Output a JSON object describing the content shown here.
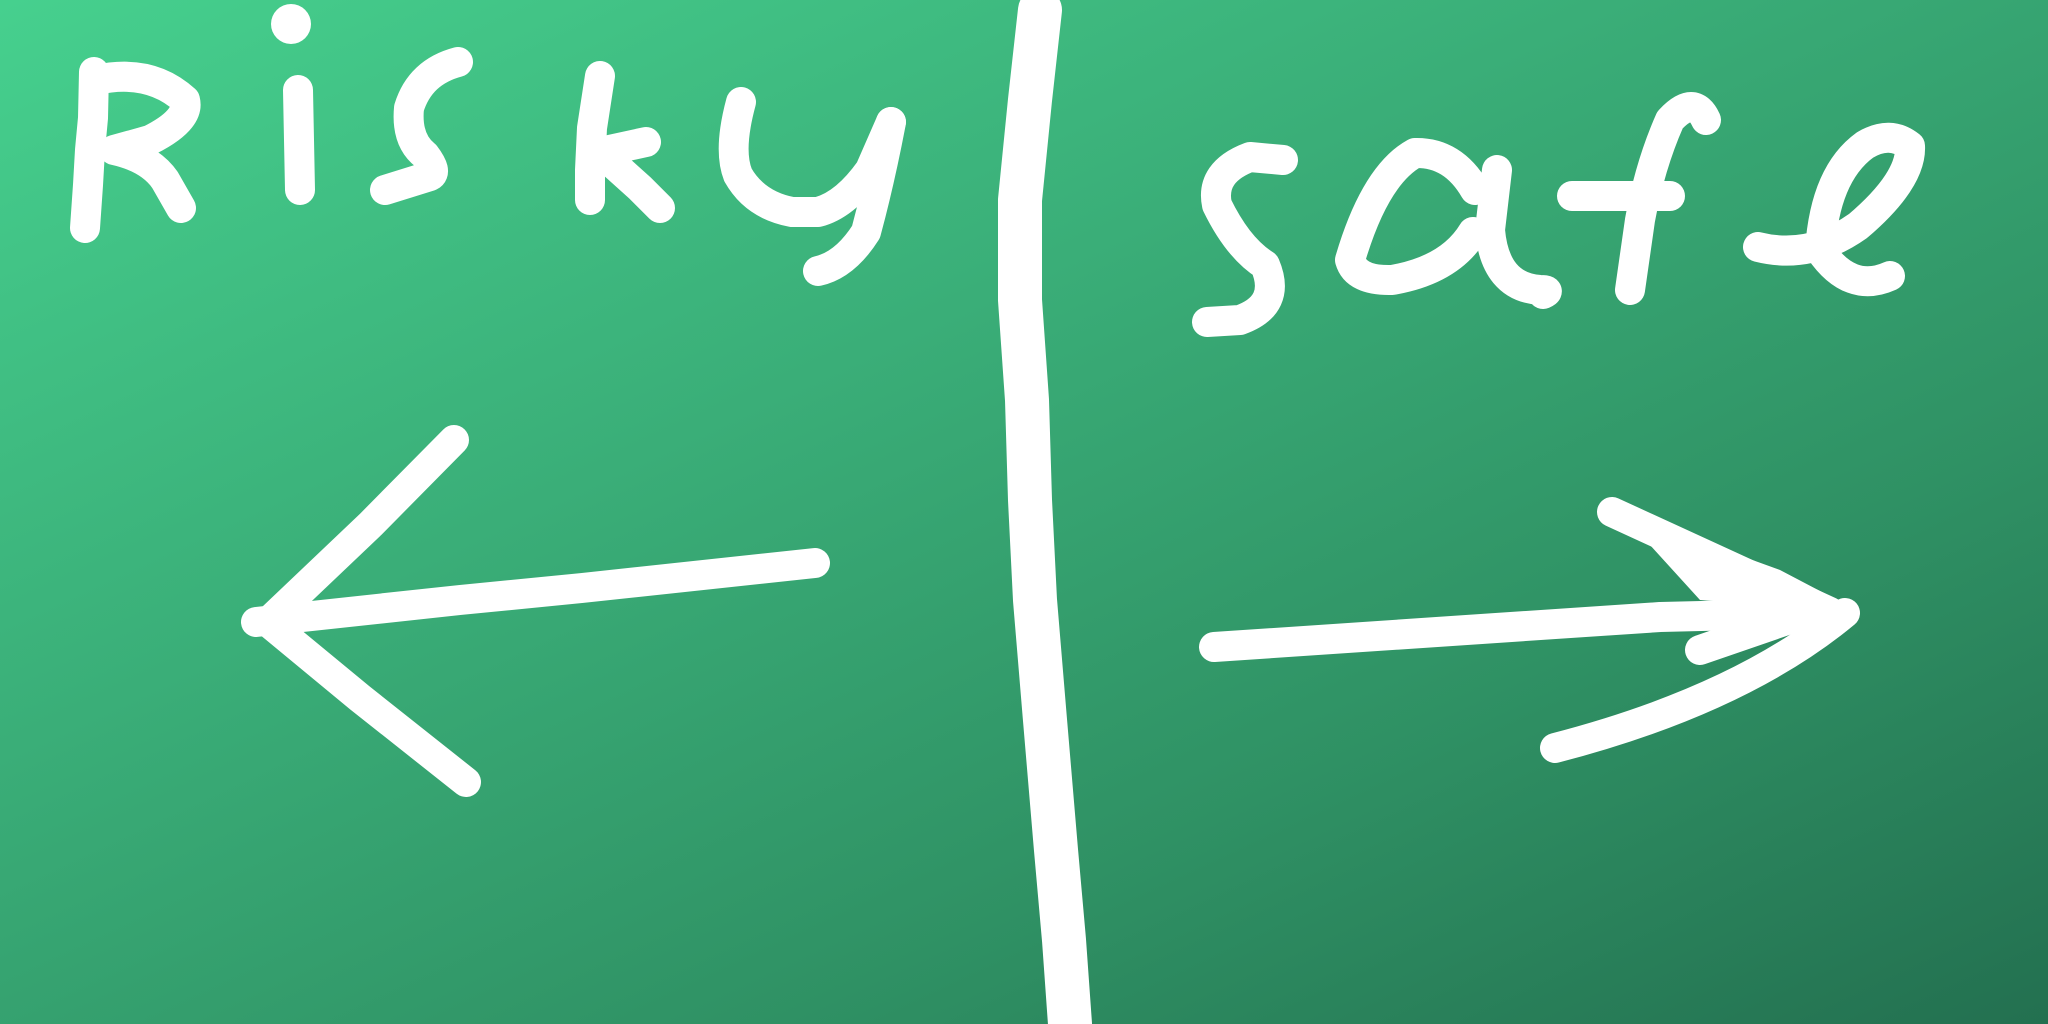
{
  "left_label": "risky",
  "right_label": "safe",
  "left_arrow_icon": "arrow-left-icon",
  "right_arrow_icon": "arrow-right-icon",
  "colors": {
    "background_start": "#46d08e",
    "background_end": "#237050",
    "ink": "#ffffff"
  }
}
